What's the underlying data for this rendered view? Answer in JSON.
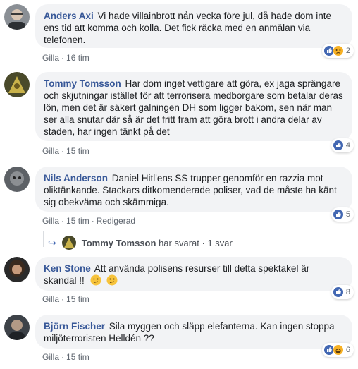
{
  "comments": [
    {
      "author": "Anders Axi",
      "text": "Vi hade villainbrott nån vecka före jul, då hade dom inte ens tid att komma och kolla. Det fick räcka med en anmälan via telefonen.",
      "like": "Gilla",
      "time": "16 tim",
      "reaction_count": "2",
      "reactions": [
        "like-icon",
        "sad-icon"
      ]
    },
    {
      "author": "Tommy Tomsson",
      "text": "Har dom inget vettigare att göra, ex jaga sprängare och skjutningar istället för att terrorisera medborgare som betalar deras lön, men det är säkert galningen DH som ligger bakom, sen när man ser alla snutar där så är det fritt fram att göra brott i andra delar av staden, har ingen tänkt på det",
      "like": "Gilla",
      "time": "15 tim",
      "reaction_count": "4",
      "reactions": [
        "like-icon"
      ]
    },
    {
      "author": "Nils Anderson",
      "text": "Daniel Hitl'ens SS trupper genomför en razzia mot oliktänkande. Stackars ditkomenderade poliser, vad de måste ha känt sig obekväma och skämmiga.",
      "like": "Gilla",
      "time": "15 tim",
      "edited": "Redigerad",
      "reaction_count": "5",
      "reactions": [
        "like-icon"
      ]
    },
    {
      "author": "Ken Stone",
      "text": "Att använda polisens resurser till detta spektakel är skandal !!",
      "like": "Gilla",
      "time": "15 tim",
      "reaction_count": "8",
      "reactions": [
        "like-icon"
      ]
    },
    {
      "author": "Björn Fischer",
      "text": "Sila myggen och släpp elefanterna. Kan ingen stoppa miljöterroristen Helldén ??",
      "like": "Gilla",
      "time": "15 tim",
      "reaction_count": "6",
      "reactions": [
        "like-icon",
        "haha-icon"
      ]
    }
  ],
  "reply": {
    "author": "Tommy Tomsson",
    "action": "har svarat",
    "count": "1 svar"
  },
  "colors": {
    "author": "#385898",
    "bubble": "#f2f3f5",
    "like": "#4267b2",
    "sad": "#f7b125"
  }
}
